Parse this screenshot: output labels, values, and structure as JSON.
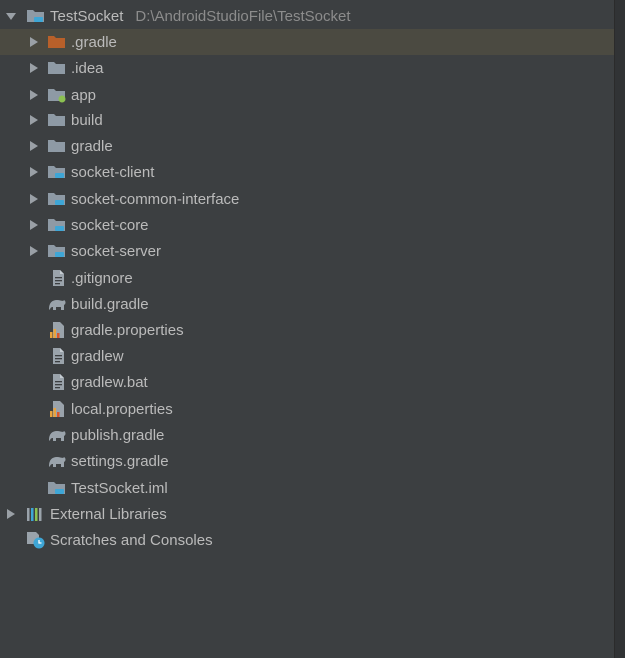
{
  "root": {
    "label": "TestSocket",
    "path": "D:\\AndroidStudioFile\\TestSocket",
    "icon": "module-folder-icon"
  },
  "items": [
    {
      "label": ".gradle",
      "icon": "folder-excluded-icon",
      "expandable": true,
      "selected": true
    },
    {
      "label": ".idea",
      "icon": "folder-icon",
      "expandable": true
    },
    {
      "label": "app",
      "icon": "android-module-folder-icon",
      "expandable": true
    },
    {
      "label": "build",
      "icon": "folder-icon",
      "expandable": true
    },
    {
      "label": "gradle",
      "icon": "folder-icon",
      "expandable": true
    },
    {
      "label": "socket-client",
      "icon": "module-folder-icon",
      "expandable": true
    },
    {
      "label": "socket-common-interface",
      "icon": "module-folder-icon",
      "expandable": true
    },
    {
      "label": "socket-core",
      "icon": "module-folder-icon",
      "expandable": true
    },
    {
      "label": "socket-server",
      "icon": "module-folder-icon",
      "expandable": true
    },
    {
      "label": ".gitignore",
      "icon": "text-file-icon"
    },
    {
      "label": "build.gradle",
      "icon": "gradle-elephant-icon"
    },
    {
      "label": "gradle.properties",
      "icon": "properties-file-icon"
    },
    {
      "label": "gradlew",
      "icon": "text-file-icon"
    },
    {
      "label": "gradlew.bat",
      "icon": "text-file-icon"
    },
    {
      "label": "local.properties",
      "icon": "properties-file-icon"
    },
    {
      "label": "publish.gradle",
      "icon": "gradle-elephant-icon"
    },
    {
      "label": "settings.gradle",
      "icon": "gradle-elephant-icon"
    },
    {
      "label": "TestSocket.iml",
      "icon": "iml-file-icon"
    }
  ],
  "external_libraries": {
    "label": "External Libraries",
    "icon": "libraries-icon"
  },
  "scratches": {
    "label": "Scratches and Consoles",
    "icon": "scratches-icon"
  },
  "colors": {
    "background": "#3c3f41",
    "selection": "#4b4a41",
    "text": "#bbbbbb",
    "path_text": "#8c8c8c",
    "folder": "#8e9aa5",
    "excluded_folder": "#b8602a",
    "module_badge": "#3ea6d6",
    "android_badge": "#8cc152"
  }
}
